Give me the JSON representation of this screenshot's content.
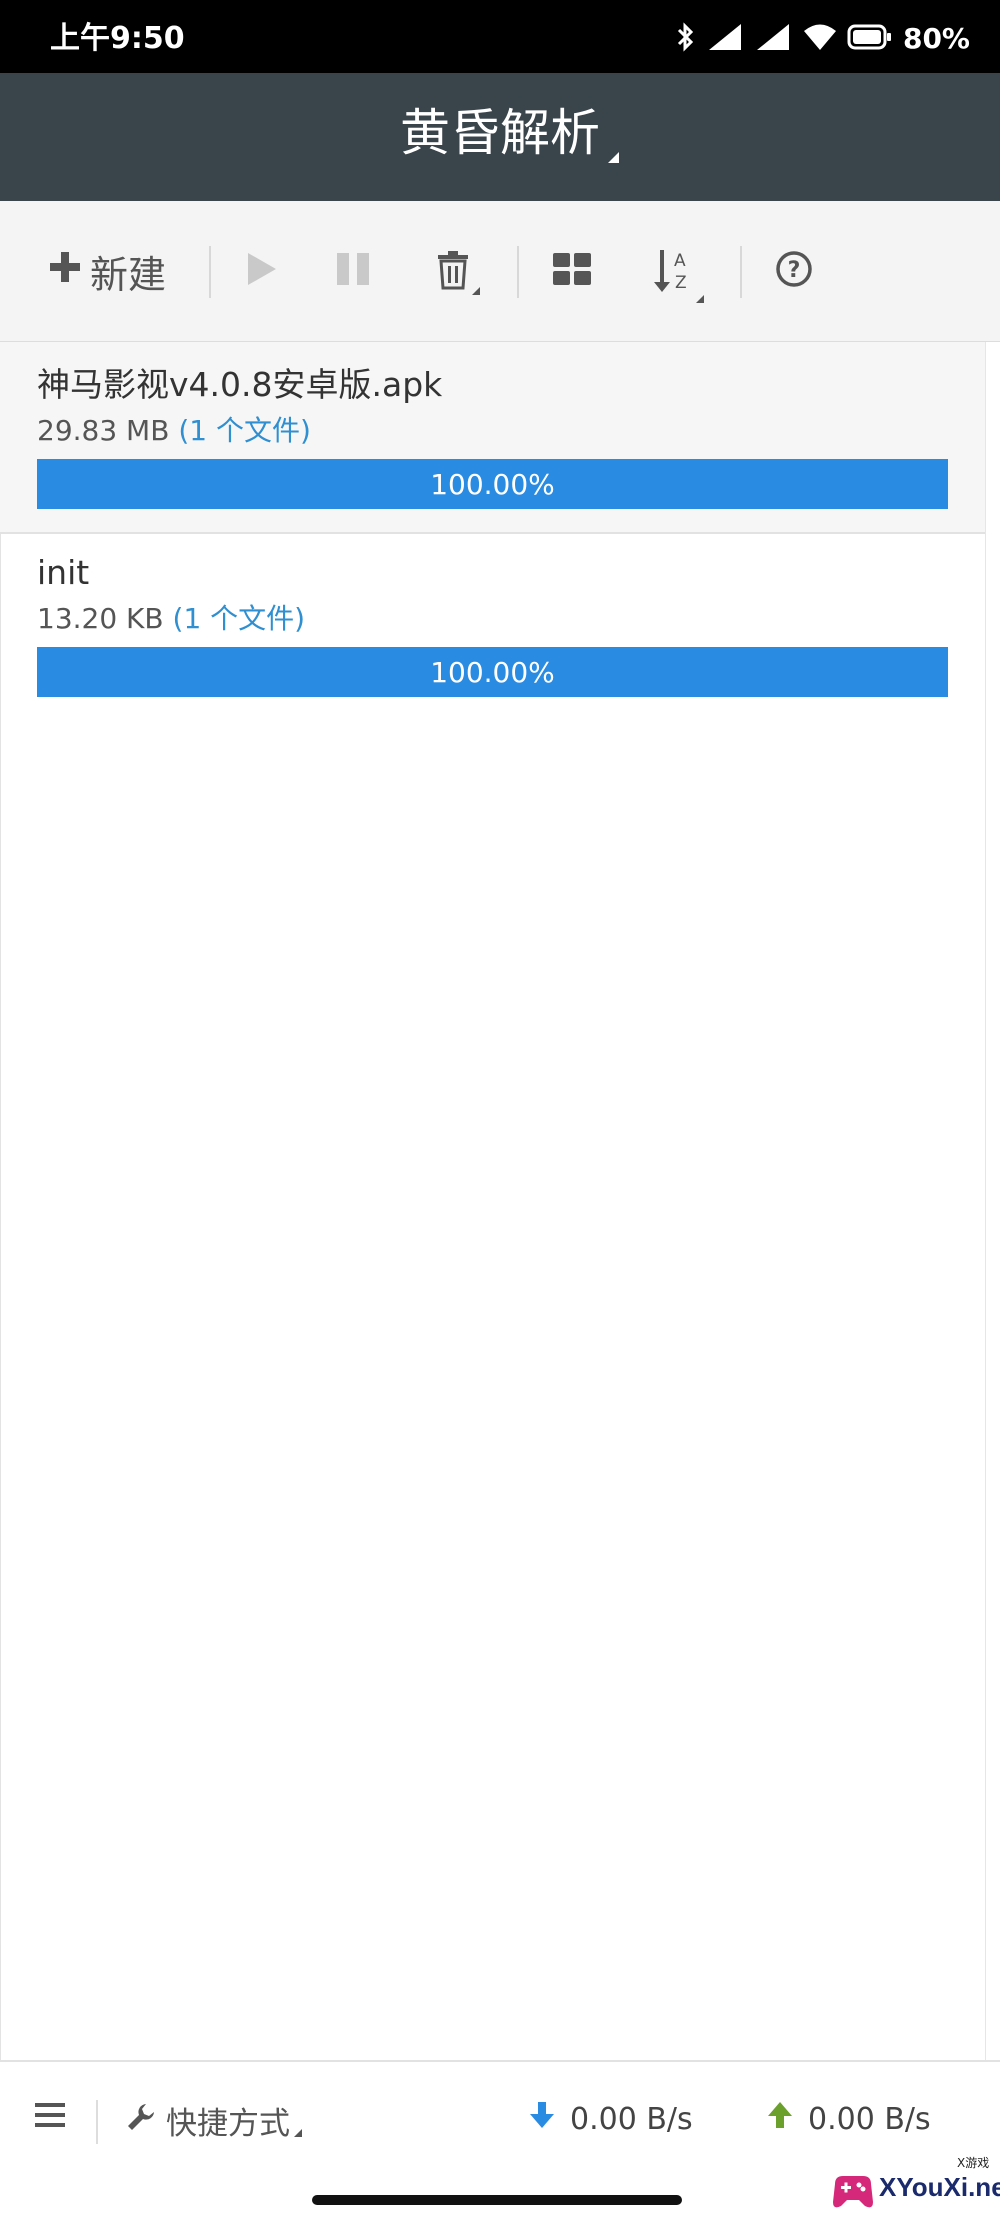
{
  "status_bar": {
    "time": "上午9:50",
    "battery": "80%",
    "icons": [
      "bluetooth-icon",
      "signal-icon",
      "signal-icon",
      "wifi-icon",
      "battery-icon"
    ]
  },
  "title_bar": {
    "title": "黄昏解析"
  },
  "toolbar": {
    "new_label": "新建",
    "buttons": [
      "plus-icon",
      "play-icon",
      "pause-icon",
      "trash-icon",
      "grid-view-icon",
      "sort-az-icon",
      "help-icon"
    ]
  },
  "downloads": [
    {
      "name": "神马影视v4.0.8安卓版.apk",
      "size": "29.83 MB",
      "files": "(1 个文件)",
      "progress_text": "100.00%",
      "progress": 1.0
    },
    {
      "name": "init",
      "size": "13.20 KB",
      "files": "(1 个文件)",
      "progress_text": "100.00%",
      "progress": 1.0
    }
  ],
  "footer": {
    "shortcut_label": "快捷方式",
    "download_speed": "0.00 B/s",
    "upload_speed": "0.00 B/s"
  },
  "watermark": {
    "text": "XYouXi.net",
    "small_text": "X游戏"
  },
  "colors": {
    "title_bg": "#39444b",
    "progress": "#2a8be2",
    "link": "#2f8fd0",
    "download_arrow": "#2a8be2",
    "upload_arrow": "#6aa02b"
  }
}
